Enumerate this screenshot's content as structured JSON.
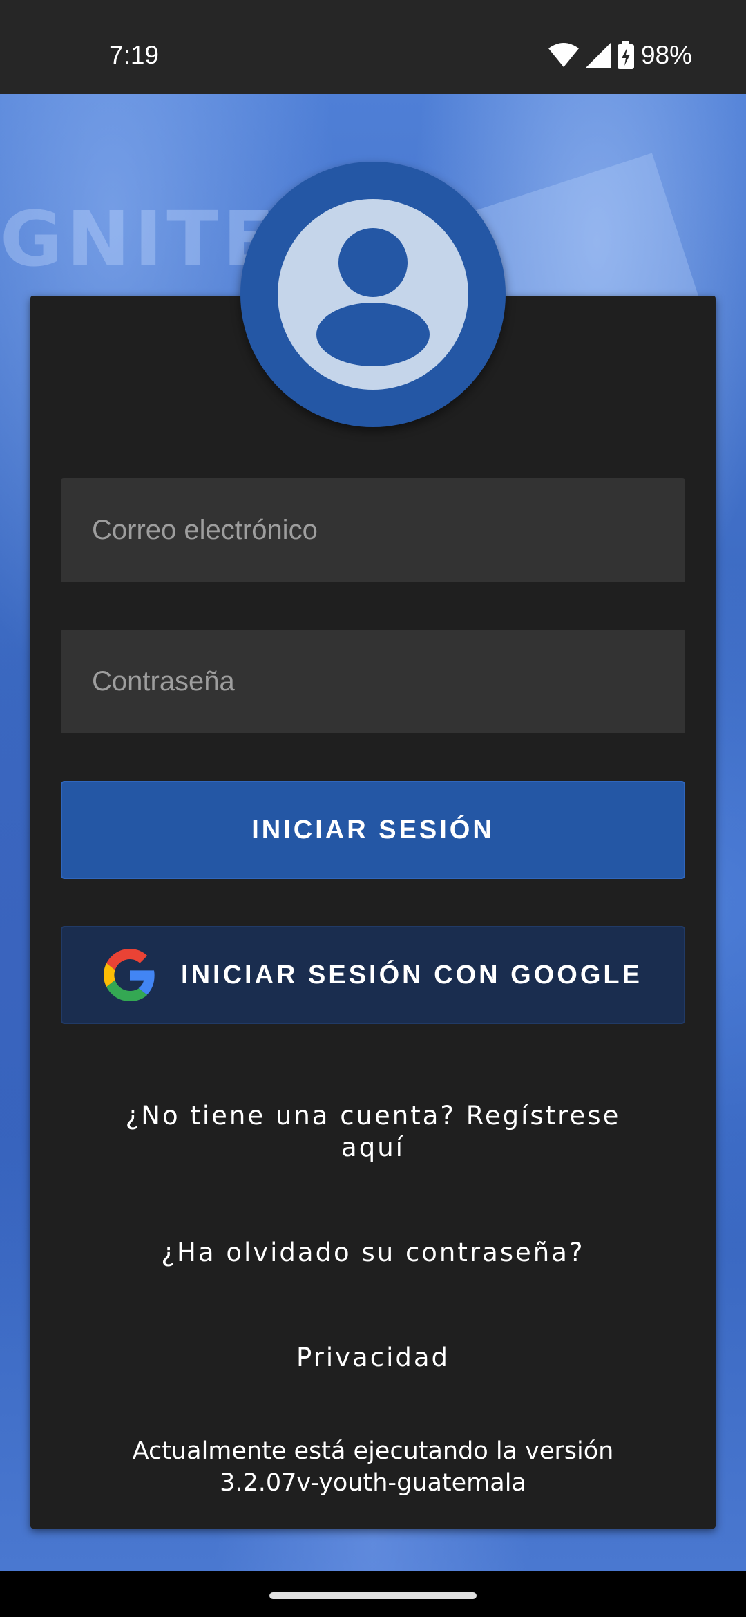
{
  "status_bar": {
    "time": "7:19",
    "battery": "98%"
  },
  "background": {
    "letters": "GNITE"
  },
  "form": {
    "email_placeholder": "Correo electrónico",
    "password_placeholder": "Contraseña",
    "login_button": "INICIAR SESIÓN",
    "google_button": "INICIAR SESIÓN CON GOOGLE"
  },
  "links": {
    "register_line1": "¿No tiene una cuenta? Regístrese",
    "register_line2": "aquí",
    "forgot_password": "¿Ha olvidado su contraseña?",
    "privacy": "Privacidad"
  },
  "version": {
    "line1": "Actualmente está ejecutando la versión",
    "line2": "3.2.07v-youth-guatemala"
  },
  "icons": {
    "avatar": "account-circle-icon",
    "google": "google-logo-icon",
    "wifi": "wifi-icon",
    "signal": "cellular-signal-icon",
    "battery": "battery-charging-icon"
  },
  "colors": {
    "primary": "#2457a5",
    "google_button": "#1a2d4f",
    "card": "#1f1f1f",
    "field": "#333333",
    "background_tint": "#3a68c0"
  }
}
